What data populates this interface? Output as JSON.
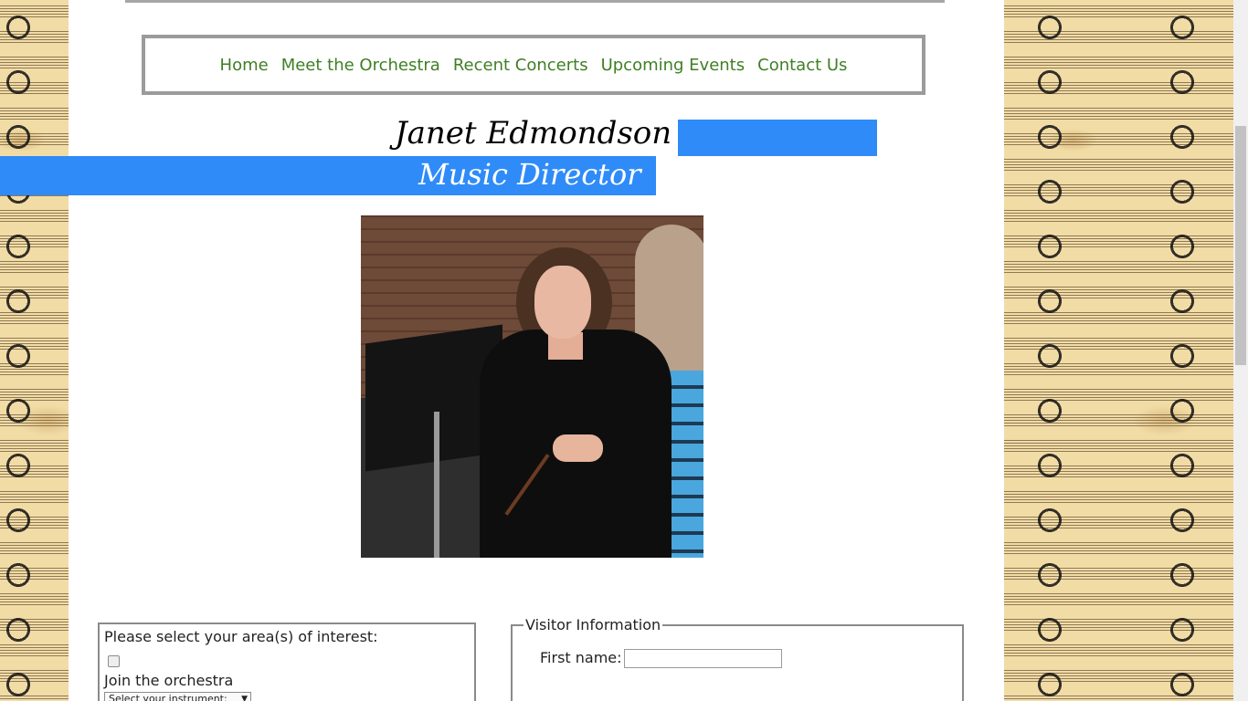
{
  "nav": {
    "items": [
      {
        "label": "Home"
      },
      {
        "label": "Meet the Orchestra"
      },
      {
        "label": "Recent Concerts"
      },
      {
        "label": "Upcoming Events"
      },
      {
        "label": "Contact Us"
      }
    ]
  },
  "header": {
    "name": "Janet Edmondson",
    "role": "Music Director"
  },
  "photo": {
    "icon": "conductor-photo"
  },
  "interest_form": {
    "prompt": "Please select your area(s) of interest:",
    "option_label": "Join the orchestra",
    "instrument_select": "Select your instrument:"
  },
  "visitor_form": {
    "legend": "Visitor Information",
    "first_name_label": "First name:",
    "first_name_value": ""
  },
  "colors": {
    "accent_blue": "#2f8bf8",
    "nav_green": "#3e7f24",
    "frame_gray": "#9b9b9b"
  }
}
